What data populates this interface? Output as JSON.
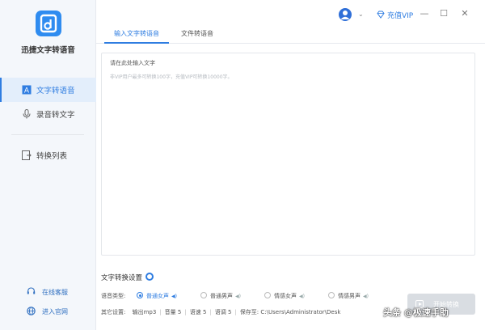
{
  "app": {
    "name": "迅捷文字转语音"
  },
  "sidebar": {
    "items": [
      {
        "label": "文字转语音",
        "icon": "text-to-speech-icon",
        "active": true
      },
      {
        "label": "录音转文字",
        "icon": "microphone-icon",
        "active": false
      },
      {
        "label": "转换列表",
        "icon": "list-icon",
        "active": false
      }
    ],
    "footer": [
      {
        "label": "在线客服",
        "icon": "customer-service-icon"
      },
      {
        "label": "进入官网",
        "icon": "globe-icon"
      }
    ]
  },
  "titlebar": {
    "vip_label": "充值VIP",
    "minimize": "—",
    "maximize": "☐",
    "close": "✕"
  },
  "tabs": [
    {
      "label": "输入文字转语音",
      "active": true
    },
    {
      "label": "文件转语音",
      "active": false
    }
  ],
  "editor": {
    "placeholder": "请在此处输入文字",
    "hint": "非VIP用户最多可转换100字，充值VIP可转换10000字。"
  },
  "settings": {
    "title": "文字转换设置",
    "voice_label": "语音类型:",
    "voices": [
      {
        "label": "普通女声",
        "selected": true
      },
      {
        "label": "普通男声",
        "selected": false
      },
      {
        "label": "情感女声",
        "selected": false
      },
      {
        "label": "情感男声",
        "selected": false
      }
    ],
    "other_label": "其它设置:",
    "format": "输出mp3",
    "volume": "音量 5",
    "speed": "语速 5",
    "pitch": "语调 5",
    "save_to": "保存至: C:\\Users\\Administrator\\Desk"
  },
  "start_button": {
    "label": "开始转换"
  },
  "watermark": "头条 @极速手助",
  "colors": {
    "accent": "#2f7de1",
    "sidebar_bg": "#f4f7fb"
  }
}
